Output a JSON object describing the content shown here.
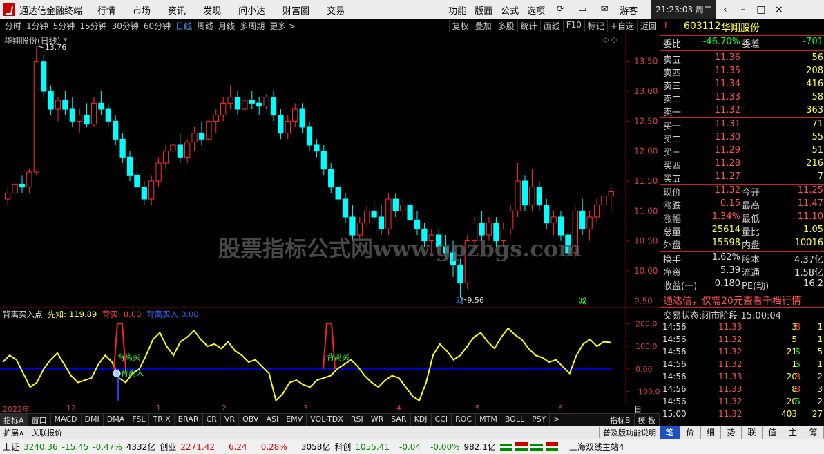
{
  "app": {
    "title": "通达信金融终端",
    "menus": [
      "行情",
      "市场",
      "资讯",
      "发现",
      "问小达",
      "财富圈",
      "交易"
    ],
    "right_menus": [
      "功能",
      "版面",
      "公式",
      "选项"
    ],
    "user": "游客",
    "clock": "21:23:03 周二"
  },
  "toolbar": {
    "periods": [
      "分时",
      "1分钟",
      "5分钟",
      "15分钟",
      "30分钟",
      "60分钟",
      "日线",
      "周线",
      "月线",
      "多周期",
      "更多 >"
    ],
    "selected": "日线",
    "tools": [
      "复权",
      "叠加",
      "多股",
      "统计",
      "画线",
      "F10",
      "标记",
      "+自选",
      "返回"
    ]
  },
  "chart": {
    "title": "华翔股份(日线)",
    "high_label": "13.76",
    "low_label": "9.56",
    "marker_cai": "财",
    "marker_jian": "减",
    "watermark": "股票指标公式网www.gpzbgs.com",
    "price_axis": [
      "13.50",
      "13.00",
      "12.50",
      "12.00",
      "11.50",
      "11.00",
      "10.50",
      "10.00",
      "9.50"
    ],
    "candles": [
      [
        11.2,
        11.4,
        11.1,
        11.3
      ],
      [
        11.3,
        11.5,
        11.2,
        11.45
      ],
      [
        11.45,
        11.6,
        11.3,
        11.4
      ],
      [
        11.4,
        11.7,
        11.3,
        11.65
      ],
      [
        11.65,
        13.76,
        11.6,
        13.5
      ],
      [
        13.5,
        13.6,
        12.9,
        13.0
      ],
      [
        13.0,
        13.1,
        12.6,
        12.7
      ],
      [
        12.7,
        12.9,
        12.5,
        12.85
      ],
      [
        12.85,
        13.0,
        12.6,
        12.7
      ],
      [
        12.7,
        12.9,
        12.4,
        12.5
      ],
      [
        12.5,
        12.7,
        12.3,
        12.6
      ],
      [
        12.6,
        12.8,
        12.4,
        12.45
      ],
      [
        12.45,
        12.9,
        12.4,
        12.8
      ],
      [
        12.8,
        13.0,
        12.6,
        12.7
      ],
      [
        12.7,
        12.8,
        12.4,
        12.5
      ],
      [
        12.5,
        12.6,
        12.1,
        12.2
      ],
      [
        12.2,
        12.3,
        11.8,
        11.9
      ],
      [
        11.9,
        12.0,
        11.5,
        11.6
      ],
      [
        11.6,
        11.8,
        11.3,
        11.4
      ],
      [
        11.4,
        11.5,
        11.1,
        11.2
      ],
      [
        11.2,
        11.6,
        11.1,
        11.5
      ],
      [
        11.5,
        11.9,
        11.4,
        11.8
      ],
      [
        11.8,
        12.1,
        11.7,
        12.0
      ],
      [
        12.0,
        12.2,
        11.9,
        12.1
      ],
      [
        12.1,
        12.3,
        11.8,
        11.9
      ],
      [
        11.9,
        12.2,
        11.8,
        12.15
      ],
      [
        12.15,
        12.4,
        12.0,
        12.3
      ],
      [
        12.3,
        12.5,
        12.1,
        12.2
      ],
      [
        12.2,
        12.6,
        12.1,
        12.5
      ],
      [
        12.5,
        12.7,
        12.3,
        12.6
      ],
      [
        12.6,
        12.9,
        12.5,
        12.8
      ],
      [
        12.8,
        13.1,
        12.7,
        12.9
      ],
      [
        12.9,
        13.0,
        12.6,
        12.7
      ],
      [
        12.7,
        12.9,
        12.6,
        12.85
      ],
      [
        12.85,
        13.0,
        12.7,
        12.8
      ],
      [
        12.8,
        12.9,
        12.6,
        12.75
      ],
      [
        12.75,
        12.95,
        12.7,
        12.9
      ],
      [
        12.9,
        13.0,
        12.5,
        12.6
      ],
      [
        12.6,
        12.7,
        12.2,
        12.3
      ],
      [
        12.3,
        12.6,
        12.2,
        12.5
      ],
      [
        12.5,
        12.8,
        12.4,
        12.7
      ],
      [
        12.7,
        12.8,
        12.3,
        12.4
      ],
      [
        12.4,
        12.5,
        12.0,
        12.1
      ],
      [
        12.1,
        12.2,
        11.9,
        12.0
      ],
      [
        12.0,
        12.1,
        11.6,
        11.7
      ],
      [
        11.7,
        11.8,
        11.3,
        11.4
      ],
      [
        11.4,
        11.5,
        11.1,
        11.2
      ],
      [
        11.2,
        11.3,
        10.8,
        10.9
      ],
      [
        10.9,
        11.1,
        10.5,
        10.6
      ],
      [
        10.6,
        10.9,
        10.5,
        10.8
      ],
      [
        10.8,
        11.1,
        10.7,
        11.0
      ],
      [
        11.0,
        11.2,
        10.8,
        10.9
      ],
      [
        10.9,
        11.1,
        10.6,
        10.7
      ],
      [
        10.7,
        11.3,
        10.6,
        11.2
      ],
      [
        11.2,
        11.3,
        10.9,
        11.0
      ],
      [
        11.0,
        11.2,
        10.9,
        11.1
      ],
      [
        11.1,
        11.2,
        10.8,
        10.85
      ],
      [
        10.85,
        11.0,
        10.6,
        10.7
      ],
      [
        10.7,
        10.8,
        10.4,
        10.5
      ],
      [
        10.5,
        10.7,
        10.3,
        10.6
      ],
      [
        10.6,
        10.7,
        10.3,
        10.4
      ],
      [
        10.4,
        10.6,
        10.2,
        10.3
      ],
      [
        10.3,
        10.5,
        9.9,
        10.1
      ],
      [
        10.1,
        10.2,
        9.56,
        9.8
      ],
      [
        9.8,
        10.6,
        9.7,
        10.5
      ],
      [
        10.5,
        10.9,
        10.4,
        10.8
      ],
      [
        10.8,
        11.0,
        10.5,
        10.6
      ],
      [
        10.6,
        10.9,
        10.5,
        10.8
      ],
      [
        10.8,
        10.9,
        10.4,
        10.5
      ],
      [
        10.5,
        10.8,
        10.4,
        10.7
      ],
      [
        10.7,
        11.1,
        10.6,
        11.0
      ],
      [
        11.0,
        11.8,
        10.9,
        11.5
      ],
      [
        11.5,
        11.6,
        11.0,
        11.1
      ],
      [
        11.1,
        11.7,
        11.0,
        11.4
      ],
      [
        11.4,
        11.5,
        11.0,
        11.1
      ],
      [
        11.1,
        11.2,
        10.7,
        10.8
      ],
      [
        10.8,
        11.0,
        10.6,
        10.9
      ],
      [
        10.9,
        11.0,
        10.5,
        10.6
      ],
      [
        10.6,
        10.7,
        10.2,
        10.3
      ],
      [
        10.3,
        11.1,
        10.2,
        11.0
      ],
      [
        11.0,
        11.2,
        10.6,
        10.7
      ],
      [
        10.7,
        11.0,
        10.5,
        10.9
      ],
      [
        10.9,
        11.2,
        10.8,
        11.1
      ],
      [
        11.1,
        11.3,
        10.9,
        11.25
      ],
      [
        11.25,
        11.45,
        11.0,
        11.32
      ]
    ]
  },
  "indicator": {
    "name": "背离买入点",
    "xianzhi_label": "先知:",
    "xianzhi_value": "119.89",
    "beili_label": "背买:",
    "beili_value": "0.00",
    "buy_label": "背离买入",
    "buy_value": "0.00",
    "axis": [
      "200.0",
      "100.0",
      "0.00",
      "-100.0"
    ],
    "signal": "背离买",
    "signal2": "背离入",
    "series": [
      30,
      60,
      40,
      -20,
      -80,
      -60,
      0,
      40,
      70,
      20,
      -30,
      -60,
      -50,
      -40,
      20,
      60,
      30,
      -40,
      -60,
      -20,
      0,
      60,
      130,
      160,
      100,
      60,
      120,
      140,
      170,
      130,
      100,
      110,
      90,
      120,
      80,
      60,
      30,
      40,
      10,
      -20,
      -140,
      -110,
      -60,
      -50,
      -70,
      -80,
      -50,
      -40,
      -30,
      0,
      20,
      40,
      10,
      -30,
      -60,
      -80,
      -50,
      -30,
      -40,
      -80,
      -120,
      -140,
      -60,
      60,
      110,
      80,
      40,
      60,
      100,
      140,
      160,
      120,
      90,
      140,
      180,
      150,
      130,
      90,
      60,
      50,
      30,
      40,
      10,
      -20,
      60,
      110,
      130,
      100,
      120,
      117
    ]
  },
  "dates": [
    "2022年",
    "12",
    "1",
    "2",
    "3",
    "4",
    "5",
    "6"
  ],
  "tabs": [
    "指标A",
    "窗口",
    "MACD",
    "DMI",
    "DMA",
    "FSL",
    "TRIX",
    "BRAR",
    "CR",
    "VR",
    "OBV",
    "ASI",
    "EMV",
    "VOL-TDX",
    "RSI",
    "WR",
    "SAR",
    "KDJ",
    "CCI",
    "ROC",
    "MTM",
    "BOLL",
    "PSY",
    ">"
  ],
  "tabs_right": [
    "指标B",
    "模 板"
  ],
  "ext": [
    "扩展∧",
    "关联报价"
  ],
  "ext_right": "普及版功能说明",
  "axis_bottom": "日线",
  "stock": {
    "code": "603112",
    "name": "华翔股份",
    "weibi_label": "委比",
    "weibi": "-46.70%",
    "weicha_label": "委差",
    "weicha": "-701",
    "asks": [
      [
        "卖五",
        "11.36",
        "56"
      ],
      [
        "卖四",
        "11.35",
        "208"
      ],
      [
        "卖三",
        "11.34",
        "416"
      ],
      [
        "卖二",
        "11.33",
        "58"
      ],
      [
        "卖一",
        "11.32",
        "363"
      ]
    ],
    "bids": [
      [
        "买一",
        "11.31",
        "71"
      ],
      [
        "买二",
        "11.30",
        "55"
      ],
      [
        "买三",
        "11.29",
        "51"
      ],
      [
        "买四",
        "11.28",
        "216"
      ],
      [
        "买五",
        "11.27",
        "7"
      ]
    ],
    "stats": [
      [
        "现价",
        "11.32",
        "今开",
        "11.25"
      ],
      [
        "涨跌",
        "0.15",
        "最高",
        "11.47"
      ],
      [
        "涨幅",
        "1.34%",
        "最低",
        "11.10"
      ],
      [
        "总量",
        "25614",
        "量比",
        "1.05"
      ],
      [
        "外盘",
        "15598",
        "内盘",
        "10016"
      ]
    ],
    "stats2": [
      [
        "换手",
        "1.62%",
        "股本",
        "4.37亿"
      ],
      [
        "净资",
        "5.39",
        "流通",
        "1.58亿"
      ],
      [
        "收益(一)",
        "0.180",
        "PE(动)",
        "16.2"
      ]
    ],
    "promo": "通达信，仅需20元查看千档行情",
    "trade_status": "交易状态:闭市阶段 15:00:04",
    "ticks": [
      [
        "14:56",
        "11.33",
        "3",
        "B",
        "1"
      ],
      [
        "14:56",
        "11.32",
        "5",
        "",
        "1"
      ],
      [
        "14:56",
        "11.32",
        "21",
        "S",
        "5"
      ],
      [
        "14:56",
        "11.32",
        "1",
        "S",
        "1"
      ],
      [
        "14:56",
        "11.33",
        "20",
        "B",
        "2"
      ],
      [
        "14:56",
        "11.33",
        "8",
        "B",
        "3"
      ],
      [
        "14:56",
        "11.32",
        "20",
        "S",
        "2"
      ],
      [
        "15:00",
        "11.32",
        "403",
        "",
        "27"
      ]
    ]
  },
  "right_tabs": [
    "笔",
    "价",
    "细",
    "势",
    "联",
    "值",
    "主",
    "筹"
  ],
  "status": {
    "sh_label": "上证",
    "sh": "3240.36",
    "sh_chg": "-15.45",
    "sh_pct": "-0.47%",
    "sh_amt": "4332亿",
    "cy_label": "创业",
    "cy": "2271.42",
    "cy_chg": "6.24",
    "cy_pct": "0.28%",
    "cy_amt": "3058亿",
    "kc_label": "科创",
    "kc": "1055.41",
    "kc_chg": "-0.04",
    "kc_pct": "-0.00%",
    "kc_amt": "982.1亿",
    "server": "上海双线主站4"
  },
  "colors": {
    "up": "#ff3030",
    "down": "#00ffff",
    "ind": "#ffff00",
    "zero": "#0000ff"
  }
}
